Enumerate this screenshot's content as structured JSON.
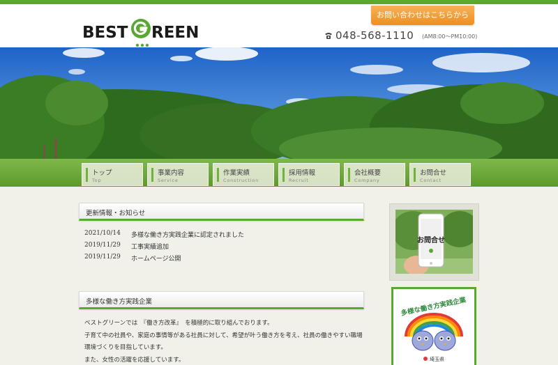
{
  "brand": {
    "logo_part1": "BEST",
    "logo_part2": "REEN",
    "accent": "#5aa832",
    "cta_color": "#ef9a2a"
  },
  "header": {
    "cta_label": "お問い合わせはこちらから",
    "phone_number": "048-568-1110",
    "phone_hours": "(AM8:00〜PM10:00)",
    "phone_icon": "telephone-icon"
  },
  "nav": {
    "items": [
      {
        "label": "トップ",
        "sub": "Top"
      },
      {
        "label": "事業内容",
        "sub": "Service"
      },
      {
        "label": "作業実績",
        "sub": "Construction"
      },
      {
        "label": "採用情報",
        "sub": "Recruit"
      },
      {
        "label": "会社概要",
        "sub": "Company"
      },
      {
        "label": "お問合せ",
        "sub": "Contact"
      }
    ]
  },
  "news": {
    "heading": "更新情報・お知らせ",
    "items": [
      {
        "date": "2021/10/14",
        "title": "多様な働き方実践企業に認定されました"
      },
      {
        "date": "2019/11/29",
        "title": "工事実績追加"
      },
      {
        "date": "2019/11/29",
        "title": "ホームページ公開"
      }
    ]
  },
  "diversity": {
    "heading": "多様な働き方実践企業",
    "lines": [
      "ベストグリーンでは　『働き方改革』　を積極的に取り組んでおります。",
      "子育て中の社員や、家庭の事情等がある社員に対して、希望が叶う働き方を考え、社員の働きやすい職場",
      "環境づくりを目指しています。",
      "また、女性の活躍を応援しています。"
    ]
  },
  "sidebar": {
    "contact_banner_text": "お問合せ",
    "badge_text": "多様な働き方実践企業",
    "badge_org": "埼玉県"
  }
}
